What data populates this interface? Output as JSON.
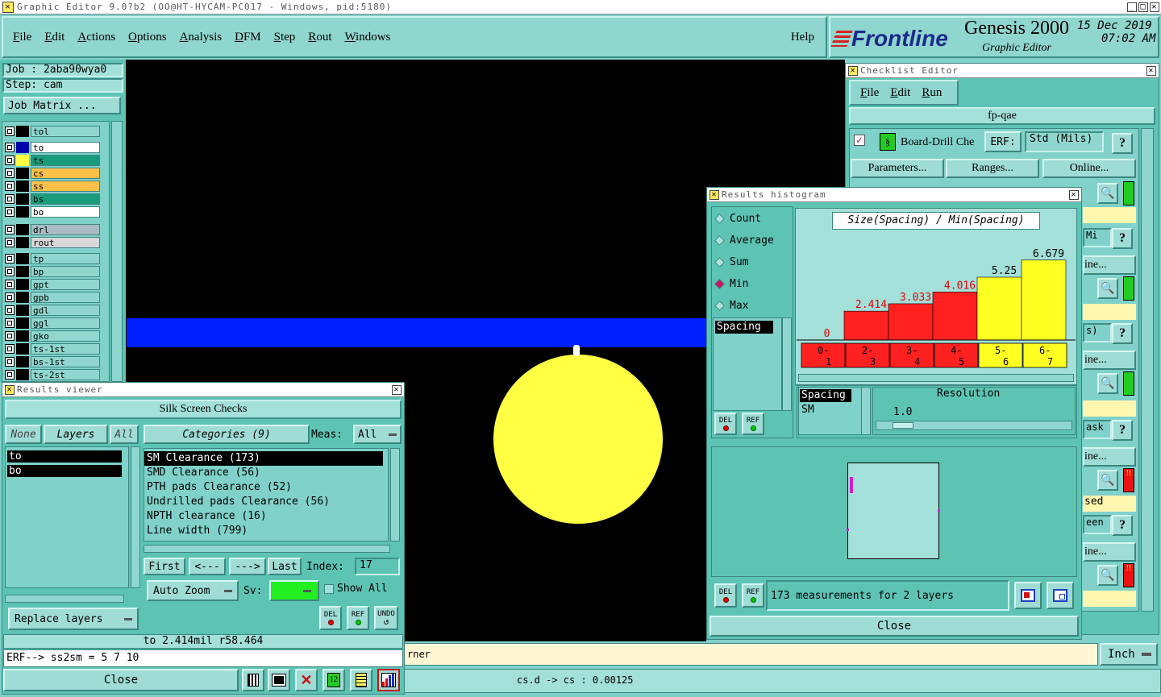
{
  "window": {
    "title": "Graphic Editor 9.0?b2 (OO@HT-HYCAM-PC017 - Windows, pid:5180)"
  },
  "menu": [
    "File",
    "Edit",
    "Actions",
    "Options",
    "Analysis",
    "DFM",
    "Step",
    "Rout",
    "Windows"
  ],
  "help_label": "Help",
  "brand": {
    "logo": "Frontline",
    "product": "Genesis 2000",
    "subtitle": "Graphic Editor",
    "date": "15 Dec 2019",
    "time": "07:02 AM"
  },
  "job": {
    "job_label": "Job : 2aba90wya0",
    "step_label": "Step: cam",
    "matrix_button": "Job Matrix ..."
  },
  "layers": [
    {
      "name": "tol",
      "bg": "#8fd6ce",
      "swatch": "#000000",
      "active": false
    },
    {
      "name": "to",
      "bg": "#ffffff",
      "swatch": "#0000aa",
      "active": true
    },
    {
      "name": "ts",
      "bg": "#1a9c7c",
      "swatch": "#ffff44",
      "active": false
    },
    {
      "name": "cs",
      "bg": "#ffc04a",
      "swatch": "#000000",
      "active": false
    },
    {
      "name": "ss",
      "bg": "#ffc04a",
      "swatch": "#000000",
      "active": false
    },
    {
      "name": "bs",
      "bg": "#1a9c7c",
      "swatch": "#000000",
      "active": false
    },
    {
      "name": "bo",
      "bg": "#ffffff",
      "swatch": "#000000",
      "active": false
    },
    {
      "name": "drl",
      "bg": "#a9bcc4",
      "swatch": "#000000",
      "active": false
    },
    {
      "name": "rout",
      "bg": "#d8d8d8",
      "swatch": "#000000",
      "active": false
    },
    {
      "name": "tp",
      "bg": "#8fd6ce",
      "swatch": "#000000",
      "active": false
    },
    {
      "name": "bp",
      "bg": "#8fd6ce",
      "swatch": "#000000",
      "active": false
    },
    {
      "name": "gpt",
      "bg": "#8fd6ce",
      "swatch": "#000000",
      "active": false
    },
    {
      "name": "gpb",
      "bg": "#8fd6ce",
      "swatch": "#000000",
      "active": false
    },
    {
      "name": "gdl",
      "bg": "#8fd6ce",
      "swatch": "#000000",
      "active": false
    },
    {
      "name": "ggl",
      "bg": "#8fd6ce",
      "swatch": "#000000",
      "active": false
    },
    {
      "name": "gko",
      "bg": "#8fd6ce",
      "swatch": "#000000",
      "active": false
    },
    {
      "name": "ts-1st",
      "bg": "#8fd6ce",
      "swatch": "#000000",
      "active": false
    },
    {
      "name": "bs-1st",
      "bg": "#8fd6ce",
      "swatch": "#000000",
      "active": false
    },
    {
      "name": "ts-2st",
      "bg": "#8fd6ce",
      "swatch": "#000000",
      "active": false
    }
  ],
  "results_viewer": {
    "title": "Results viewer",
    "header": "Silk Screen Checks",
    "none_btn": "None",
    "layers_btn": "Layers",
    "all_btn": "All",
    "categories_btn": "Categories (9)",
    "meas_label": "Meas:",
    "meas_value": "All",
    "layer_list": [
      "to",
      "bo"
    ],
    "categories": [
      "SM Clearance (173)",
      "SMD Clearance (56)",
      "PTH pads Clearance (52)",
      "Undrilled pads Clearance (56)",
      "NPTH clearance (16)",
      "Line width (799)"
    ],
    "first": "First",
    "prev": "<---",
    "next": "--->",
    "last": "Last",
    "index_label": "Index:",
    "index_value": "17",
    "auto_zoom": "Auto Zoom",
    "sv_label": "Sv:",
    "show_all": "Show All",
    "replace_layers": "Replace layers",
    "del": "DEL",
    "ref": "REF",
    "undo": "UNDO",
    "status": "to 2.414mil  r58.464",
    "erf": "ERF--> ss2sm = 5 7 10",
    "close": "Close"
  },
  "checklist": {
    "title": "Checklist Editor",
    "menu": [
      "File",
      "Edit",
      "Run"
    ],
    "name": "fp-qae",
    "action_name": "Board-Drill Che",
    "erf_label": "ERF:",
    "erf_value": "Std (Mils)",
    "parameters": "Parameters...",
    "ranges": "Ranges...",
    "online": "Online...",
    "fragments": [
      "Mi",
      "ine...",
      "s)",
      "ine...",
      "ask",
      "ine...",
      "sed",
      "een",
      "ine..."
    ]
  },
  "histogram": {
    "title": "Results histogram",
    "options": [
      "Count",
      "Average",
      "Sum",
      "Min",
      "Max"
    ],
    "selected": "Min",
    "measure_list": [
      "Spacing"
    ],
    "chart_title": "Size(Spacing) / Min(Spacing)",
    "resolution_label": "Resolution",
    "resolution_value": "1.0",
    "sel_list": [
      "Spacing",
      "SM"
    ],
    "summary": "173 measurements for 2 layers",
    "close": "Close",
    "del": "DEL",
    "ref": "REF"
  },
  "chart_data": {
    "type": "bar",
    "title": "Size(Spacing) / Min(Spacing)",
    "categories": [
      "0-1",
      "2-3",
      "3-4",
      "4-5",
      "5-6",
      "6-7"
    ],
    "values": [
      0,
      2.414,
      3.033,
      4.016,
      5.25,
      6.679
    ],
    "value_labels": [
      "0",
      "2.414",
      "3.033",
      "4.016",
      "5.25",
      "6.679"
    ],
    "colors": [
      "#ff2020",
      "#ff2020",
      "#ff2020",
      "#ff2020",
      "#ffff22",
      "#ffff22"
    ],
    "ylim": [
      0,
      7
    ]
  },
  "bottom": {
    "message": "rner",
    "units": "Inch",
    "status": "cs.d -> cs : 0.00125"
  },
  "colors": {
    "canvas": "#000000",
    "blue_line": "#0020ff",
    "pad": "#ffff44"
  }
}
